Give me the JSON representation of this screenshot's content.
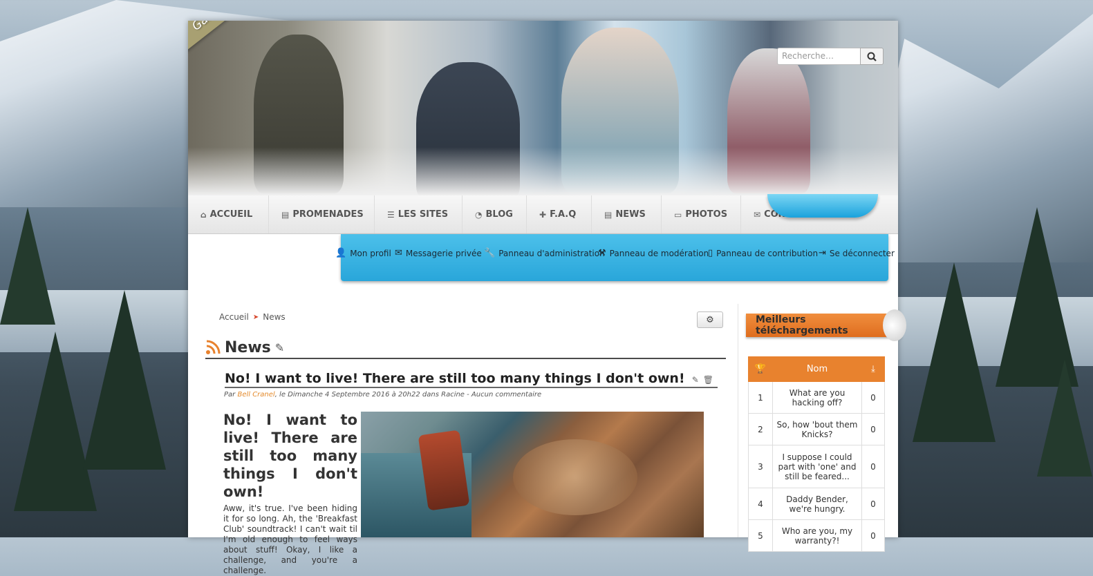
{
  "header": {
    "ribbon_label": "Game Team",
    "search_placeholder": "Recherche…",
    "search_icon": "search-icon"
  },
  "nav": {
    "items": [
      {
        "label": "ACCUEIL",
        "icon": "home-icon"
      },
      {
        "label": "PROMENADES",
        "icon": "newspaper-icon"
      },
      {
        "label": "LES SITES",
        "icon": "list-icon"
      },
      {
        "label": "BLOG",
        "icon": "rss-icon"
      },
      {
        "label": "F.A.Q",
        "icon": "medkit-icon"
      },
      {
        "label": "NEWS",
        "icon": "newspaper-icon"
      },
      {
        "label": "PHOTOS",
        "icon": "monitor-icon"
      },
      {
        "label": "CONTACT",
        "icon": "envelope-icon"
      }
    ]
  },
  "user_toolbar": {
    "items": [
      {
        "label": "Mon profil",
        "icon": "user-icon"
      },
      {
        "label": "Messagerie privée",
        "icon": "envelope-icon"
      },
      {
        "label": "Panneau d'administration",
        "icon": "wrench-icon"
      },
      {
        "label": "Panneau de modération",
        "icon": "gavel-icon"
      },
      {
        "label": "Panneau de contribution",
        "icon": "file-icon"
      },
      {
        "label": "Se déconnecter",
        "icon": "sign-out-icon"
      }
    ]
  },
  "breadcrumb": {
    "home": "Accueil",
    "separator": "➤",
    "current": "News"
  },
  "page": {
    "title": "News",
    "article": {
      "title": "No! I want to live! There are still too many things I don't own!",
      "meta_prefix": "Par ",
      "author": "Bell Cranel",
      "meta_suffix": ", le Dimanche 4 Septembre 2016 à 20h22 dans Racine - Aucun commentaire",
      "body_heading": "No! I want to live! There are still too many things I don't own!",
      "body_text": "Aww, it's true. I've been hiding it for so long. Ah, the 'Breakfast Club' soundtrack! I can't wait til I'm old enough to feel ways about stuff! Okay, I like a challenge, and you're a challenge."
    }
  },
  "sidebar": {
    "title": "Meilleurs téléchargements",
    "table": {
      "header_rank_icon": "trophy-icon",
      "header_name": "Nom",
      "header_count_icon": "download-icon",
      "rows": [
        {
          "rank": "1",
          "name": "What are you hacking off?",
          "count": "0"
        },
        {
          "rank": "2",
          "name": "So, how 'bout them Knicks?",
          "count": "0"
        },
        {
          "rank": "3",
          "name": "I suppose I could part with 'one' and still be feared...",
          "count": "0"
        },
        {
          "rank": "4",
          "name": "Daddy Bender, we're hungry.",
          "count": "0"
        },
        {
          "rank": "5",
          "name": "Who are you, my warranty?!",
          "count": "0"
        }
      ]
    }
  },
  "colors": {
    "accent_blue": "#29a6da",
    "accent_orange": "#e8822e",
    "author_link": "#e48a2b",
    "breadcrumb_arrow": "#d6452a"
  }
}
